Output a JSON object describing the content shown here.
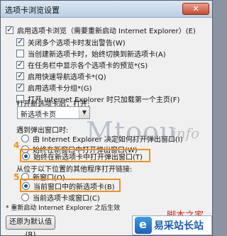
{
  "dialog": {
    "title": "选项卡浏览设置",
    "close_glyph": "✕"
  },
  "options": {
    "enable_tabs": "启用选项卡浏览（需要重新启动 Internet Explorer）(E)",
    "warn_close": "关闭多个选项卡时发出警告(W)",
    "switch_new_tab": "当创建新选项卡时，始终切换到新选项卡(A)",
    "taskbar_previews": "在任务栏中显示各个选项卡的预览*(S)",
    "quick_tabs": "启用快速导航选项卡*(Q)",
    "tab_groups": "启用选项卡分组*(G)",
    "open_home_only": "打开 Internet Explorer 时只加载第一个主页(F)"
  },
  "new_tab_section": {
    "label": "打开新选项卡后，打开:",
    "select_value": "新选项卡页"
  },
  "popup_section": {
    "label": "遇到弹出窗口时:",
    "let_ie_decide": "由 Internet Explorer 决定如何打开弹出窗口(I)",
    "always_new_window": "始终在新窗口中打开弹出窗口(W)",
    "always_new_tab": "始终在新选项卡中打开弹出窗口(T)"
  },
  "external_section": {
    "label": "从位于以下位置的其他程序打开链接:",
    "new_window": "新窗口(O)",
    "current_window_new_tab": "当前窗口中的新选项卡(B)",
    "current_tab_or_window": "当前选项卡或窗口(C)"
  },
  "footer": {
    "note": "* 重新启动 Internet Explorer 之后生效",
    "restore_defaults": "还原为默认值(R)"
  },
  "annotations": {
    "num4": "4",
    "num5": "5",
    "color": "#f0901b"
  },
  "watermarks": {
    "mtoou": "Mtoou",
    "info": ".info",
    "red_text": "脚本之家",
    "site": "易采站长站"
  },
  "state": {
    "enable_tabs": true,
    "warn_close": true,
    "switch_new_tab": false,
    "taskbar_previews": true,
    "quick_tabs": true,
    "tab_groups": true,
    "open_home_only": false,
    "popup_choice": "always_new_tab",
    "external_choice": "current_window_new_tab"
  }
}
